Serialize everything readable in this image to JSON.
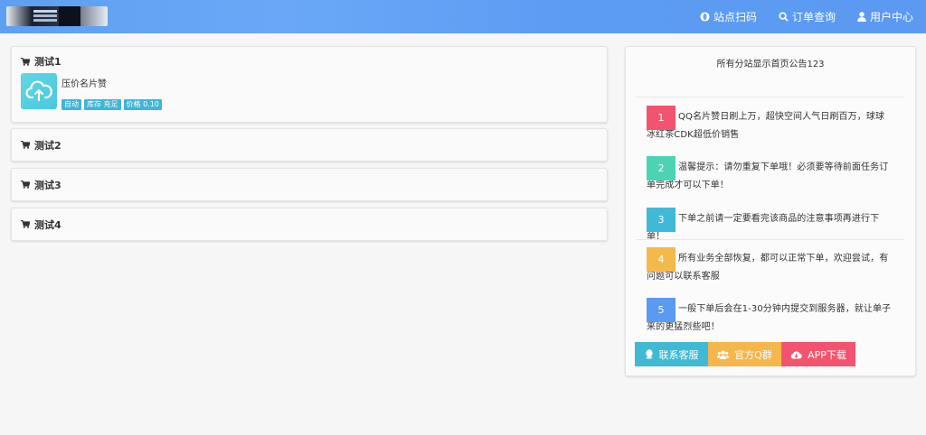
{
  "nav": {
    "items": [
      {
        "label": "站点扫码",
        "icon": "site-icon"
      },
      {
        "label": "订单查询",
        "icon": "search-icon"
      },
      {
        "label": "用户中心",
        "icon": "user-icon"
      }
    ]
  },
  "categories": [
    {
      "name": "测试1",
      "icon": "cart-icon"
    },
    {
      "name": "测试2",
      "icon": "cart-icon"
    },
    {
      "name": "测试3",
      "icon": "cart-icon"
    },
    {
      "name": "测试4",
      "icon": "cart-icon"
    }
  ],
  "product": {
    "name": "压价名片赞",
    "icon": "cloud-upload-icon",
    "tags": [
      "自动",
      "库存 充足",
      "价格 0.10"
    ]
  },
  "panel": {
    "announcement": "所有分站显示首页公告123",
    "notices": [
      {
        "num": "1",
        "color": "#f2546f",
        "text": "QQ名片赞日刷上万，超快空间人气日刷百万，球球冰红茶CDK超低价销售"
      },
      {
        "num": "2",
        "color": "#4cd3b3",
        "text": "温馨提示：请勿重复下单哦！必须要等待前面任务订单完成才可以下单！"
      },
      {
        "num": "3",
        "color": "#3fb9d6",
        "text": "下单之前请一定要看完该商品的注意事项再进行下单！"
      },
      {
        "num": "4",
        "color": "#f5b94b",
        "text": "所有业务全部恢复，都可以正常下单，欢迎尝试，有问题可以联系客服"
      },
      {
        "num": "5",
        "color": "#5a9af3",
        "text": "一般下单后会在1-30分钟内提交到服务器，就让单子来的更猛烈些吧！"
      }
    ],
    "buttons": [
      {
        "label": "联系客服",
        "color": "#40b9d4",
        "icon": "qq-icon"
      },
      {
        "label": "官方Q群",
        "color": "#f6b64b",
        "icon": "group-icon"
      },
      {
        "label": "APP下载",
        "color": "#f2546f",
        "icon": "cloud-download-icon"
      }
    ]
  }
}
